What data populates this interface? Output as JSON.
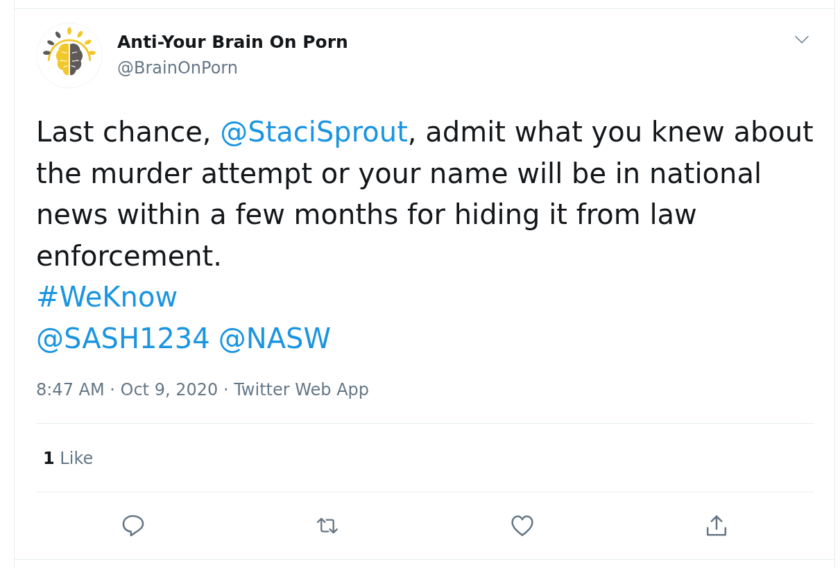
{
  "tweet": {
    "author": {
      "name": "Anti-Your Brain On Porn",
      "handle": "@BrainOnPorn"
    },
    "lines": [
      {
        "segments": [
          {
            "kind": "text",
            "text": "Last chance, "
          },
          {
            "kind": "mention",
            "text": "@StaciSprout"
          },
          {
            "kind": "text",
            "text": ", admit what you knew about the murder attempt or your name will be in national news within a few months for hiding it from law enforcement."
          }
        ]
      },
      {
        "segments": [
          {
            "kind": "hashtag",
            "text": "#WeKnow"
          }
        ]
      },
      {
        "segments": [
          {
            "kind": "mention",
            "text": "@SASH1234"
          },
          {
            "kind": "mention",
            "text": "@NASW"
          }
        ]
      }
    ],
    "meta": "8:47 AM · Oct 9, 2020 · Twitter Web App",
    "stats": [
      {
        "count": "1",
        "label": "Like"
      }
    ]
  }
}
